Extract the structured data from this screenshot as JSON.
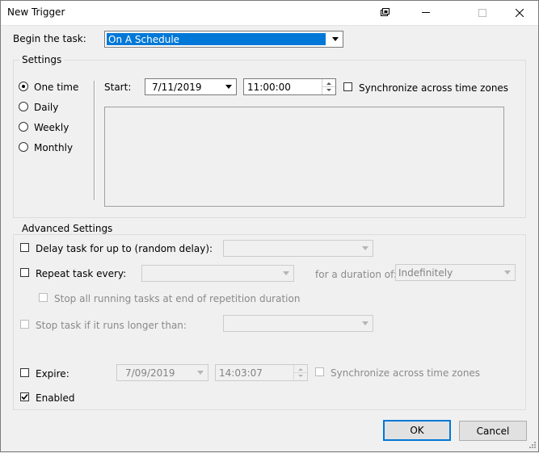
{
  "window": {
    "title": "New Trigger"
  },
  "begin": {
    "label": "Begin the task:",
    "value": "On A Schedule"
  },
  "settings": {
    "label": "Settings",
    "options": [
      {
        "label": "One time",
        "selected": true
      },
      {
        "label": "Daily",
        "selected": false
      },
      {
        "label": "Weekly",
        "selected": false
      },
      {
        "label": "Monthly",
        "selected": false
      }
    ],
    "start_label": "Start:",
    "start_date": "7/11/2019",
    "start_time": "11:00:00",
    "sync_label": "Synchronize across time zones"
  },
  "advanced": {
    "label": "Advanced Settings",
    "delay_label": "Delay task for up to (random delay):",
    "repeat_label": "Repeat task every:",
    "duration_label": "for a duration of:",
    "duration_value": "Indefinitely",
    "stop_all_label": "Stop all running tasks at end of repetition duration",
    "stop_if_label": "Stop task if it runs longer than:",
    "expire_label": "Expire:",
    "expire_date": "7/09/2019",
    "expire_time": "14:03:07",
    "expire_sync_label": "Synchronize across time zones",
    "enabled_label": "Enabled"
  },
  "buttons": {
    "ok": "OK",
    "cancel": "Cancel"
  }
}
